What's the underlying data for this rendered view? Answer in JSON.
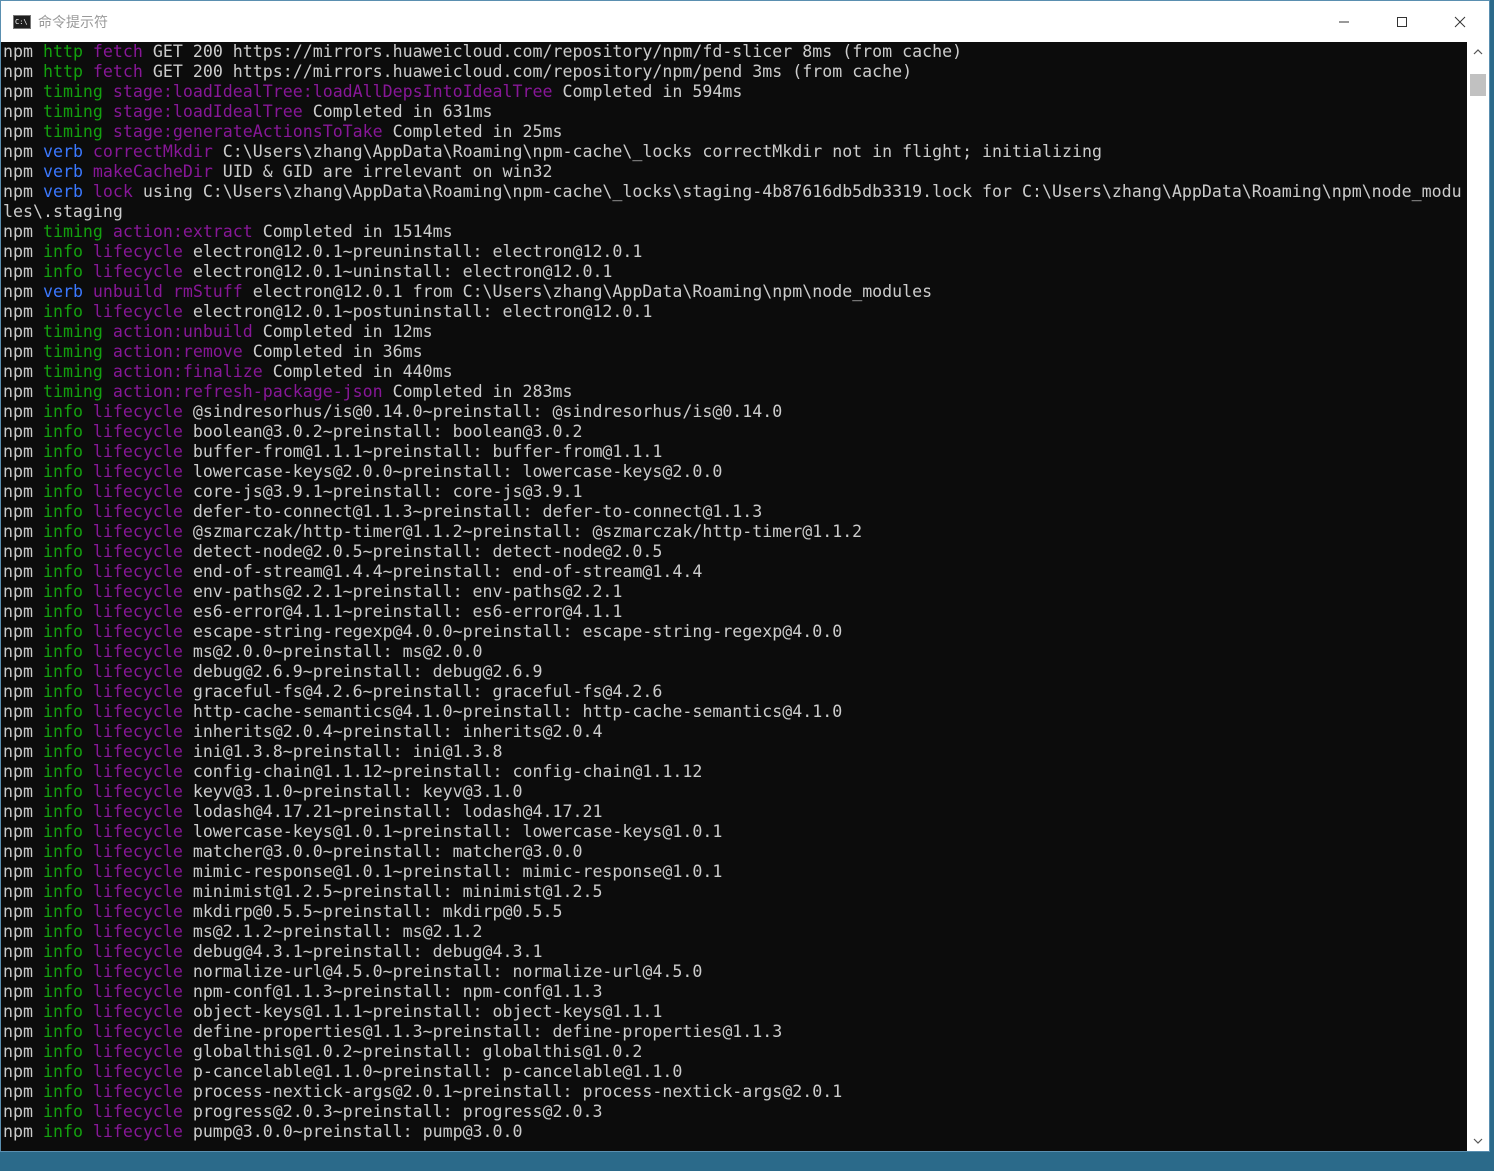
{
  "window": {
    "title": "命令提示符",
    "icon_label": "C:\\",
    "controls": [
      "minimize",
      "maximize",
      "close"
    ]
  },
  "colors": {
    "background": "#0c0c0c",
    "text": "#cccccc",
    "green": "#13a10e",
    "blue": "#3b78ff",
    "magenta": "#881798"
  },
  "scrollbar": {
    "position_fraction": 0.02
  },
  "console": {
    "lines": [
      {
        "segs": [
          [
            "npm ",
            "c-npm"
          ],
          [
            "http ",
            "c-http"
          ],
          [
            "fetch ",
            "c-mag"
          ],
          [
            "GET 200 https://mirrors.huaweicloud.com/repository/npm/fd-slicer 8ms (from cache)",
            "c-txt"
          ]
        ]
      },
      {
        "segs": [
          [
            "npm ",
            "c-npm"
          ],
          [
            "http ",
            "c-http"
          ],
          [
            "fetch ",
            "c-mag"
          ],
          [
            "GET 200 https://mirrors.huaweicloud.com/repository/npm/pend 3ms (from cache)",
            "c-txt"
          ]
        ]
      },
      {
        "segs": [
          [
            "npm ",
            "c-npm"
          ],
          [
            "timing ",
            "c-timing"
          ],
          [
            "stage:loadIdealTree:loadAllDepsIntoIdealTree ",
            "c-mag"
          ],
          [
            "Completed in 594ms",
            "c-txt"
          ]
        ]
      },
      {
        "segs": [
          [
            "npm ",
            "c-npm"
          ],
          [
            "timing ",
            "c-timing"
          ],
          [
            "stage:loadIdealTree ",
            "c-mag"
          ],
          [
            "Completed in 631ms",
            "c-txt"
          ]
        ]
      },
      {
        "segs": [
          [
            "npm ",
            "c-npm"
          ],
          [
            "timing ",
            "c-timing"
          ],
          [
            "stage:generateActionsToTake ",
            "c-mag"
          ],
          [
            "Completed in 25ms",
            "c-txt"
          ]
        ]
      },
      {
        "segs": [
          [
            "npm ",
            "c-npm"
          ],
          [
            "verb ",
            "c-verb"
          ],
          [
            "correctMkdir ",
            "c-mag"
          ],
          [
            "C:\\Users\\zhang\\AppData\\Roaming\\npm-cache\\_locks correctMkdir not in flight; initializing",
            "c-txt"
          ]
        ]
      },
      {
        "segs": [
          [
            "npm ",
            "c-npm"
          ],
          [
            "verb ",
            "c-verb"
          ],
          [
            "makeCacheDir ",
            "c-mag"
          ],
          [
            "UID & GID are irrelevant on win32",
            "c-txt"
          ]
        ]
      },
      {
        "wrap": true,
        "segs": [
          [
            "npm ",
            "c-npm"
          ],
          [
            "verb ",
            "c-verb"
          ],
          [
            "lock ",
            "c-mag"
          ],
          [
            "using C:\\Users\\zhang\\AppData\\Roaming\\npm-cache\\_locks\\staging-4b87616db5db3319.lock for C:\\Users\\zhang\\AppData\\Roaming\\npm\\node_modules\\.staging",
            "c-txt"
          ]
        ]
      },
      {
        "segs": [
          [
            "npm ",
            "c-npm"
          ],
          [
            "timing ",
            "c-timing"
          ],
          [
            "action:extract ",
            "c-mag"
          ],
          [
            "Completed in 1514ms",
            "c-txt"
          ]
        ]
      },
      {
        "segs": [
          [
            "npm ",
            "c-npm"
          ],
          [
            "info ",
            "c-info"
          ],
          [
            "lifecycle ",
            "c-mag"
          ],
          [
            "electron@12.0.1~preuninstall: electron@12.0.1",
            "c-txt"
          ]
        ]
      },
      {
        "segs": [
          [
            "npm ",
            "c-npm"
          ],
          [
            "info ",
            "c-info"
          ],
          [
            "lifecycle ",
            "c-mag"
          ],
          [
            "electron@12.0.1~uninstall: electron@12.0.1",
            "c-txt"
          ]
        ]
      },
      {
        "segs": [
          [
            "npm ",
            "c-npm"
          ],
          [
            "verb ",
            "c-verb"
          ],
          [
            "unbuild rmStuff ",
            "c-mag"
          ],
          [
            "electron@12.0.1 from C:\\Users\\zhang\\AppData\\Roaming\\npm\\node_modules",
            "c-txt"
          ]
        ]
      },
      {
        "segs": [
          [
            "npm ",
            "c-npm"
          ],
          [
            "info ",
            "c-info"
          ],
          [
            "lifecycle ",
            "c-mag"
          ],
          [
            "electron@12.0.1~postuninstall: electron@12.0.1",
            "c-txt"
          ]
        ]
      },
      {
        "segs": [
          [
            "npm ",
            "c-npm"
          ],
          [
            "timing ",
            "c-timing"
          ],
          [
            "action:unbuild ",
            "c-mag"
          ],
          [
            "Completed in 12ms",
            "c-txt"
          ]
        ]
      },
      {
        "segs": [
          [
            "npm ",
            "c-npm"
          ],
          [
            "timing ",
            "c-timing"
          ],
          [
            "action:remove ",
            "c-mag"
          ],
          [
            "Completed in 36ms",
            "c-txt"
          ]
        ]
      },
      {
        "segs": [
          [
            "npm ",
            "c-npm"
          ],
          [
            "timing ",
            "c-timing"
          ],
          [
            "action:finalize ",
            "c-mag"
          ],
          [
            "Completed in 440ms",
            "c-txt"
          ]
        ]
      },
      {
        "segs": [
          [
            "npm ",
            "c-npm"
          ],
          [
            "timing ",
            "c-timing"
          ],
          [
            "action:refresh-package-json ",
            "c-mag"
          ],
          [
            "Completed in 283ms",
            "c-txt"
          ]
        ]
      },
      {
        "segs": [
          [
            "npm ",
            "c-npm"
          ],
          [
            "info ",
            "c-info"
          ],
          [
            "lifecycle ",
            "c-mag"
          ],
          [
            "@sindresorhus/is@0.14.0~preinstall: @sindresorhus/is@0.14.0",
            "c-txt"
          ]
        ]
      },
      {
        "segs": [
          [
            "npm ",
            "c-npm"
          ],
          [
            "info ",
            "c-info"
          ],
          [
            "lifecycle ",
            "c-mag"
          ],
          [
            "boolean@3.0.2~preinstall: boolean@3.0.2",
            "c-txt"
          ]
        ]
      },
      {
        "segs": [
          [
            "npm ",
            "c-npm"
          ],
          [
            "info ",
            "c-info"
          ],
          [
            "lifecycle ",
            "c-mag"
          ],
          [
            "buffer-from@1.1.1~preinstall: buffer-from@1.1.1",
            "c-txt"
          ]
        ]
      },
      {
        "segs": [
          [
            "npm ",
            "c-npm"
          ],
          [
            "info ",
            "c-info"
          ],
          [
            "lifecycle ",
            "c-mag"
          ],
          [
            "lowercase-keys@2.0.0~preinstall: lowercase-keys@2.0.0",
            "c-txt"
          ]
        ]
      },
      {
        "segs": [
          [
            "npm ",
            "c-npm"
          ],
          [
            "info ",
            "c-info"
          ],
          [
            "lifecycle ",
            "c-mag"
          ],
          [
            "core-js@3.9.1~preinstall: core-js@3.9.1",
            "c-txt"
          ]
        ]
      },
      {
        "segs": [
          [
            "npm ",
            "c-npm"
          ],
          [
            "info ",
            "c-info"
          ],
          [
            "lifecycle ",
            "c-mag"
          ],
          [
            "defer-to-connect@1.1.3~preinstall: defer-to-connect@1.1.3",
            "c-txt"
          ]
        ]
      },
      {
        "segs": [
          [
            "npm ",
            "c-npm"
          ],
          [
            "info ",
            "c-info"
          ],
          [
            "lifecycle ",
            "c-mag"
          ],
          [
            "@szmarczak/http-timer@1.1.2~preinstall: @szmarczak/http-timer@1.1.2",
            "c-txt"
          ]
        ]
      },
      {
        "segs": [
          [
            "npm ",
            "c-npm"
          ],
          [
            "info ",
            "c-info"
          ],
          [
            "lifecycle ",
            "c-mag"
          ],
          [
            "detect-node@2.0.5~preinstall: detect-node@2.0.5",
            "c-txt"
          ]
        ]
      },
      {
        "segs": [
          [
            "npm ",
            "c-npm"
          ],
          [
            "info ",
            "c-info"
          ],
          [
            "lifecycle ",
            "c-mag"
          ],
          [
            "end-of-stream@1.4.4~preinstall: end-of-stream@1.4.4",
            "c-txt"
          ]
        ]
      },
      {
        "segs": [
          [
            "npm ",
            "c-npm"
          ],
          [
            "info ",
            "c-info"
          ],
          [
            "lifecycle ",
            "c-mag"
          ],
          [
            "env-paths@2.2.1~preinstall: env-paths@2.2.1",
            "c-txt"
          ]
        ]
      },
      {
        "segs": [
          [
            "npm ",
            "c-npm"
          ],
          [
            "info ",
            "c-info"
          ],
          [
            "lifecycle ",
            "c-mag"
          ],
          [
            "es6-error@4.1.1~preinstall: es6-error@4.1.1",
            "c-txt"
          ]
        ]
      },
      {
        "segs": [
          [
            "npm ",
            "c-npm"
          ],
          [
            "info ",
            "c-info"
          ],
          [
            "lifecycle ",
            "c-mag"
          ],
          [
            "escape-string-regexp@4.0.0~preinstall: escape-string-regexp@4.0.0",
            "c-txt"
          ]
        ]
      },
      {
        "segs": [
          [
            "npm ",
            "c-npm"
          ],
          [
            "info ",
            "c-info"
          ],
          [
            "lifecycle ",
            "c-mag"
          ],
          [
            "ms@2.0.0~preinstall: ms@2.0.0",
            "c-txt"
          ]
        ]
      },
      {
        "segs": [
          [
            "npm ",
            "c-npm"
          ],
          [
            "info ",
            "c-info"
          ],
          [
            "lifecycle ",
            "c-mag"
          ],
          [
            "debug@2.6.9~preinstall: debug@2.6.9",
            "c-txt"
          ]
        ]
      },
      {
        "segs": [
          [
            "npm ",
            "c-npm"
          ],
          [
            "info ",
            "c-info"
          ],
          [
            "lifecycle ",
            "c-mag"
          ],
          [
            "graceful-fs@4.2.6~preinstall: graceful-fs@4.2.6",
            "c-txt"
          ]
        ]
      },
      {
        "segs": [
          [
            "npm ",
            "c-npm"
          ],
          [
            "info ",
            "c-info"
          ],
          [
            "lifecycle ",
            "c-mag"
          ],
          [
            "http-cache-semantics@4.1.0~preinstall: http-cache-semantics@4.1.0",
            "c-txt"
          ]
        ]
      },
      {
        "segs": [
          [
            "npm ",
            "c-npm"
          ],
          [
            "info ",
            "c-info"
          ],
          [
            "lifecycle ",
            "c-mag"
          ],
          [
            "inherits@2.0.4~preinstall: inherits@2.0.4",
            "c-txt"
          ]
        ]
      },
      {
        "segs": [
          [
            "npm ",
            "c-npm"
          ],
          [
            "info ",
            "c-info"
          ],
          [
            "lifecycle ",
            "c-mag"
          ],
          [
            "ini@1.3.8~preinstall: ini@1.3.8",
            "c-txt"
          ]
        ]
      },
      {
        "segs": [
          [
            "npm ",
            "c-npm"
          ],
          [
            "info ",
            "c-info"
          ],
          [
            "lifecycle ",
            "c-mag"
          ],
          [
            "config-chain@1.1.12~preinstall: config-chain@1.1.12",
            "c-txt"
          ]
        ]
      },
      {
        "segs": [
          [
            "npm ",
            "c-npm"
          ],
          [
            "info ",
            "c-info"
          ],
          [
            "lifecycle ",
            "c-mag"
          ],
          [
            "keyv@3.1.0~preinstall: keyv@3.1.0",
            "c-txt"
          ]
        ]
      },
      {
        "segs": [
          [
            "npm ",
            "c-npm"
          ],
          [
            "info ",
            "c-info"
          ],
          [
            "lifecycle ",
            "c-mag"
          ],
          [
            "lodash@4.17.21~preinstall: lodash@4.17.21",
            "c-txt"
          ]
        ]
      },
      {
        "segs": [
          [
            "npm ",
            "c-npm"
          ],
          [
            "info ",
            "c-info"
          ],
          [
            "lifecycle ",
            "c-mag"
          ],
          [
            "lowercase-keys@1.0.1~preinstall: lowercase-keys@1.0.1",
            "c-txt"
          ]
        ]
      },
      {
        "segs": [
          [
            "npm ",
            "c-npm"
          ],
          [
            "info ",
            "c-info"
          ],
          [
            "lifecycle ",
            "c-mag"
          ],
          [
            "matcher@3.0.0~preinstall: matcher@3.0.0",
            "c-txt"
          ]
        ]
      },
      {
        "segs": [
          [
            "npm ",
            "c-npm"
          ],
          [
            "info ",
            "c-info"
          ],
          [
            "lifecycle ",
            "c-mag"
          ],
          [
            "mimic-response@1.0.1~preinstall: mimic-response@1.0.1",
            "c-txt"
          ]
        ]
      },
      {
        "segs": [
          [
            "npm ",
            "c-npm"
          ],
          [
            "info ",
            "c-info"
          ],
          [
            "lifecycle ",
            "c-mag"
          ],
          [
            "minimist@1.2.5~preinstall: minimist@1.2.5",
            "c-txt"
          ]
        ]
      },
      {
        "segs": [
          [
            "npm ",
            "c-npm"
          ],
          [
            "info ",
            "c-info"
          ],
          [
            "lifecycle ",
            "c-mag"
          ],
          [
            "mkdirp@0.5.5~preinstall: mkdirp@0.5.5",
            "c-txt"
          ]
        ]
      },
      {
        "segs": [
          [
            "npm ",
            "c-npm"
          ],
          [
            "info ",
            "c-info"
          ],
          [
            "lifecycle ",
            "c-mag"
          ],
          [
            "ms@2.1.2~preinstall: ms@2.1.2",
            "c-txt"
          ]
        ]
      },
      {
        "segs": [
          [
            "npm ",
            "c-npm"
          ],
          [
            "info ",
            "c-info"
          ],
          [
            "lifecycle ",
            "c-mag"
          ],
          [
            "debug@4.3.1~preinstall: debug@4.3.1",
            "c-txt"
          ]
        ]
      },
      {
        "segs": [
          [
            "npm ",
            "c-npm"
          ],
          [
            "info ",
            "c-info"
          ],
          [
            "lifecycle ",
            "c-mag"
          ],
          [
            "normalize-url@4.5.0~preinstall: normalize-url@4.5.0",
            "c-txt"
          ]
        ]
      },
      {
        "segs": [
          [
            "npm ",
            "c-npm"
          ],
          [
            "info ",
            "c-info"
          ],
          [
            "lifecycle ",
            "c-mag"
          ],
          [
            "npm-conf@1.1.3~preinstall: npm-conf@1.1.3",
            "c-txt"
          ]
        ]
      },
      {
        "segs": [
          [
            "npm ",
            "c-npm"
          ],
          [
            "info ",
            "c-info"
          ],
          [
            "lifecycle ",
            "c-mag"
          ],
          [
            "object-keys@1.1.1~preinstall: object-keys@1.1.1",
            "c-txt"
          ]
        ]
      },
      {
        "segs": [
          [
            "npm ",
            "c-npm"
          ],
          [
            "info ",
            "c-info"
          ],
          [
            "lifecycle ",
            "c-mag"
          ],
          [
            "define-properties@1.1.3~preinstall: define-properties@1.1.3",
            "c-txt"
          ]
        ]
      },
      {
        "segs": [
          [
            "npm ",
            "c-npm"
          ],
          [
            "info ",
            "c-info"
          ],
          [
            "lifecycle ",
            "c-mag"
          ],
          [
            "globalthis@1.0.2~preinstall: globalthis@1.0.2",
            "c-txt"
          ]
        ]
      },
      {
        "segs": [
          [
            "npm ",
            "c-npm"
          ],
          [
            "info ",
            "c-info"
          ],
          [
            "lifecycle ",
            "c-mag"
          ],
          [
            "p-cancelable@1.1.0~preinstall: p-cancelable@1.1.0",
            "c-txt"
          ]
        ]
      },
      {
        "segs": [
          [
            "npm ",
            "c-npm"
          ],
          [
            "info ",
            "c-info"
          ],
          [
            "lifecycle ",
            "c-mag"
          ],
          [
            "process-nextick-args@2.0.1~preinstall: process-nextick-args@2.0.1",
            "c-txt"
          ]
        ]
      },
      {
        "segs": [
          [
            "npm ",
            "c-npm"
          ],
          [
            "info ",
            "c-info"
          ],
          [
            "lifecycle ",
            "c-mag"
          ],
          [
            "progress@2.0.3~preinstall: progress@2.0.3",
            "c-txt"
          ]
        ]
      },
      {
        "segs": [
          [
            "npm ",
            "c-npm"
          ],
          [
            "info ",
            "c-info"
          ],
          [
            "lifecycle ",
            "c-mag"
          ],
          [
            "pump@3.0.0~preinstall: pump@3.0.0",
            "c-txt"
          ]
        ]
      }
    ]
  }
}
